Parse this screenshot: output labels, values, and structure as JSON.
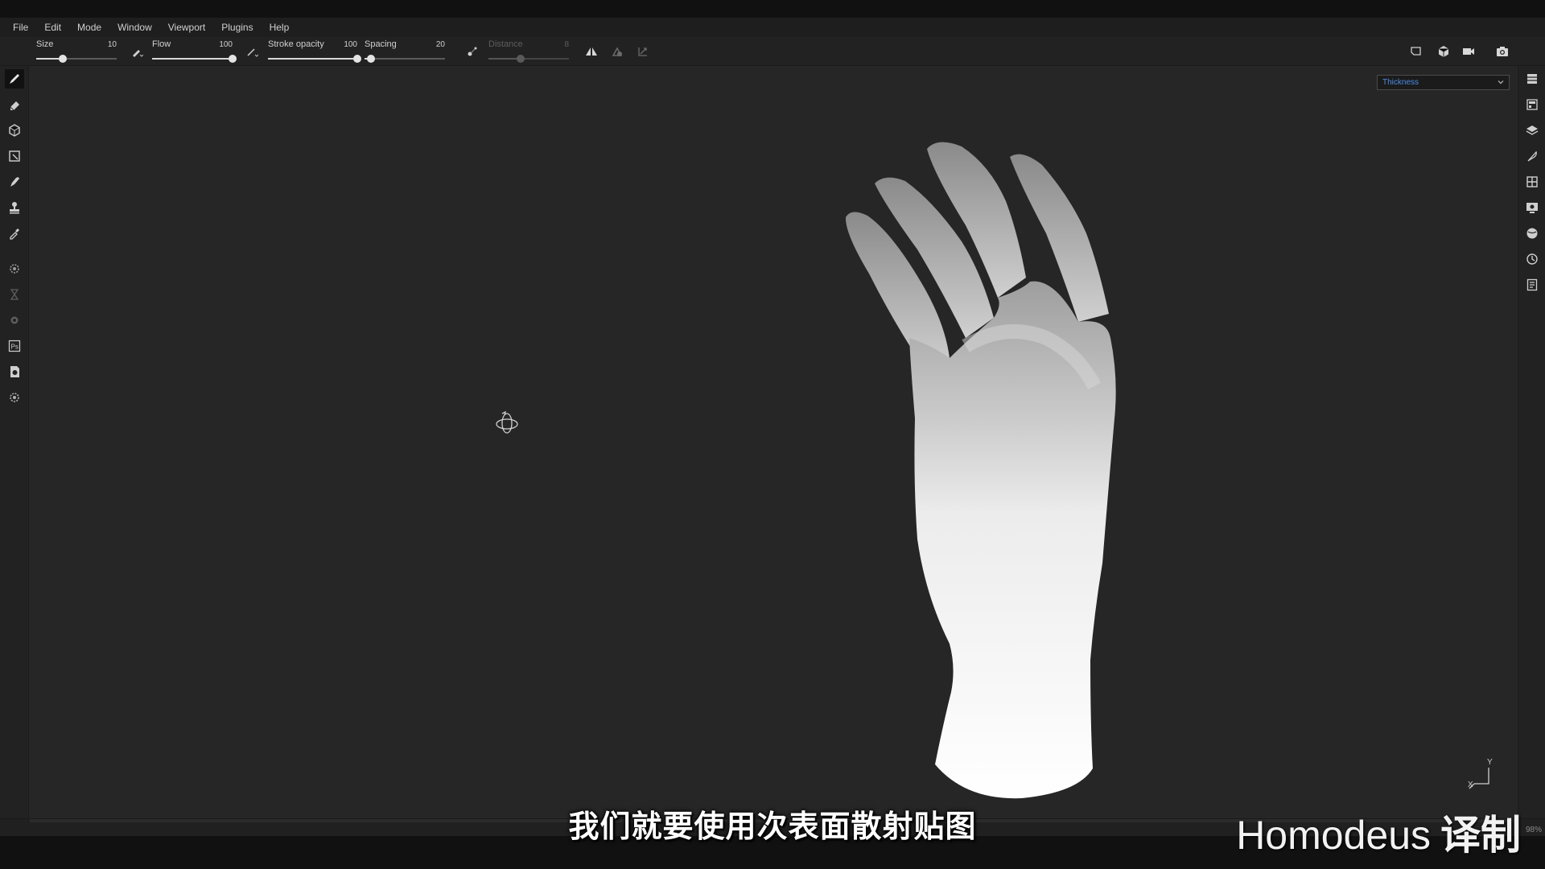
{
  "menu": {
    "items": [
      "File",
      "Edit",
      "Mode",
      "Window",
      "Viewport",
      "Plugins",
      "Help"
    ]
  },
  "toolbar": {
    "size": {
      "label": "Size",
      "value": "10",
      "fraction": 0.33
    },
    "flow": {
      "label": "Flow",
      "value": "100",
      "fraction": 1.0
    },
    "stroke_opacity": {
      "label": "Stroke opacity",
      "value": "100",
      "fraction": 1.0
    },
    "spacing": {
      "label": "Spacing",
      "value": "20",
      "fraction": 0.08
    },
    "distance": {
      "label": "Distance",
      "value": "8",
      "fraction": 0.4,
      "disabled": true
    }
  },
  "viewport": {
    "channel_selected": "Thickness"
  },
  "status": {
    "zoom": "98%"
  },
  "overlay": {
    "subtitle": "我们就要使用次表面散射贴图",
    "watermark_brand": "Homodeus",
    "watermark_cn": "译制"
  },
  "axis": {
    "y_label": "Y",
    "x_label": "X"
  },
  "colors": {
    "accent_blue": "#4b8ee6",
    "background": "#262626"
  }
}
